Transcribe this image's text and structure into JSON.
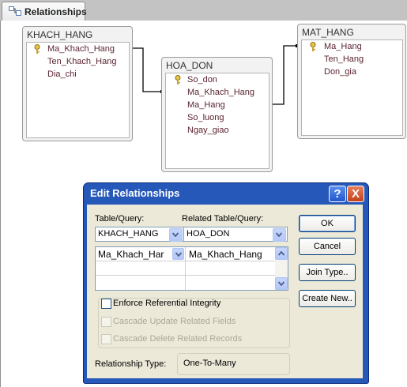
{
  "tab": {
    "label": "Relationships",
    "icon": "relationships-icon"
  },
  "tables": {
    "khach_hang": {
      "title": "KHACH_HANG",
      "fields": [
        {
          "name": "Ma_Khach_Hang",
          "key": true
        },
        {
          "name": "Ten_Khach_Hang",
          "key": false
        },
        {
          "name": "Dia_chi",
          "key": false
        }
      ]
    },
    "hoa_don": {
      "title": "HOA_DON",
      "fields": [
        {
          "name": "So_don",
          "key": true
        },
        {
          "name": "Ma_Khach_Hang",
          "key": false
        },
        {
          "name": "Ma_Hang",
          "key": false
        },
        {
          "name": "So_luong",
          "key": false
        },
        {
          "name": "Ngay_giao",
          "key": false
        }
      ]
    },
    "mat_hang": {
      "title": "MAT_HANG",
      "fields": [
        {
          "name": "Ma_Hang",
          "key": true
        },
        {
          "name": "Ten_Hang",
          "key": false
        },
        {
          "name": "Don_gia",
          "key": false
        }
      ]
    }
  },
  "dialog": {
    "title": "Edit Relationships",
    "help_label": "?",
    "close_label": "X",
    "table_query_label": "Table/Query:",
    "related_label": "Related Table/Query:",
    "table_value": "KHACH_HANG",
    "related_value": "HOA_DON",
    "grid_rows": [
      {
        "left": "Ma_Khach_Har",
        "right": "Ma_Khach_Hang"
      },
      {
        "left": "",
        "right": ""
      },
      {
        "left": "",
        "right": ""
      }
    ],
    "buttons": {
      "ok": "OK",
      "cancel": "Cancel",
      "join_type": "Join Type..",
      "create_new": "Create New.."
    },
    "enforce_label": "Enforce Referential Integrity",
    "cascade_update_label": "Cascade Update Related Fields",
    "cascade_delete_label": "Cascade Delete Related Records",
    "relationship_type_label": "Relationship Type:",
    "relationship_type_value": "One-To-Many",
    "enforce_checked": false,
    "cascade_update_checked": false,
    "cascade_delete_checked": false
  },
  "colors": {
    "title_bar": "#2558b8",
    "field_text": "#5a2430",
    "dialog_body": "#ece9d8"
  }
}
